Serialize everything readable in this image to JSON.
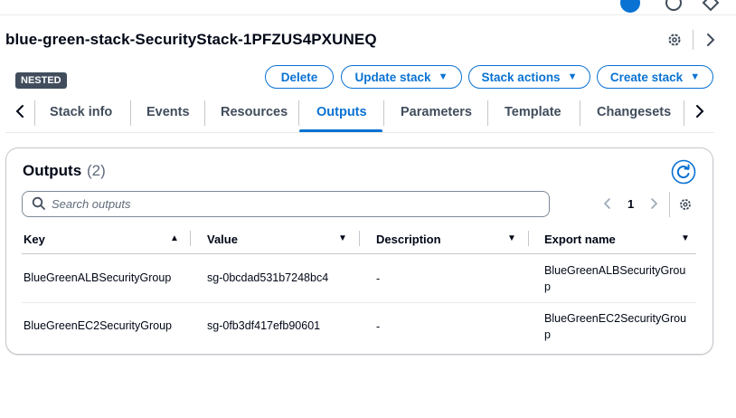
{
  "header": {
    "stack_name": "blue-green-stack-SecurityStack-1PFZUS4PXUNEQ",
    "badge": "NESTED"
  },
  "actions": {
    "delete": "Delete",
    "update": "Update stack",
    "stack_actions": "Stack actions",
    "create": "Create stack"
  },
  "tabs": [
    {
      "label": "Stack info"
    },
    {
      "label": "Events"
    },
    {
      "label": "Resources"
    },
    {
      "label": "Outputs",
      "active": true
    },
    {
      "label": "Parameters"
    },
    {
      "label": "Template"
    },
    {
      "label": "Changesets"
    }
  ],
  "outputs": {
    "title": "Outputs",
    "count": "(2)",
    "search_placeholder": "Search outputs",
    "page": "1",
    "columns": [
      "Key",
      "Value",
      "Description",
      "Export name"
    ],
    "rows": [
      {
        "key": "BlueGreenALBSecurityGroup",
        "value": "sg-0bcdad531b7248bc4",
        "description": "-",
        "export": "BlueGreenALBSecurityGroup"
      },
      {
        "key": "BlueGreenEC2SecurityGroup",
        "value": "sg-0fb3df417efb90601",
        "description": "-",
        "export": "BlueGreenEC2SecurityGroup"
      }
    ]
  },
  "colors": {
    "accent": "#0972d3",
    "text": "#000716",
    "muted": "#5f6b7a",
    "border": "#c6c6cd"
  }
}
